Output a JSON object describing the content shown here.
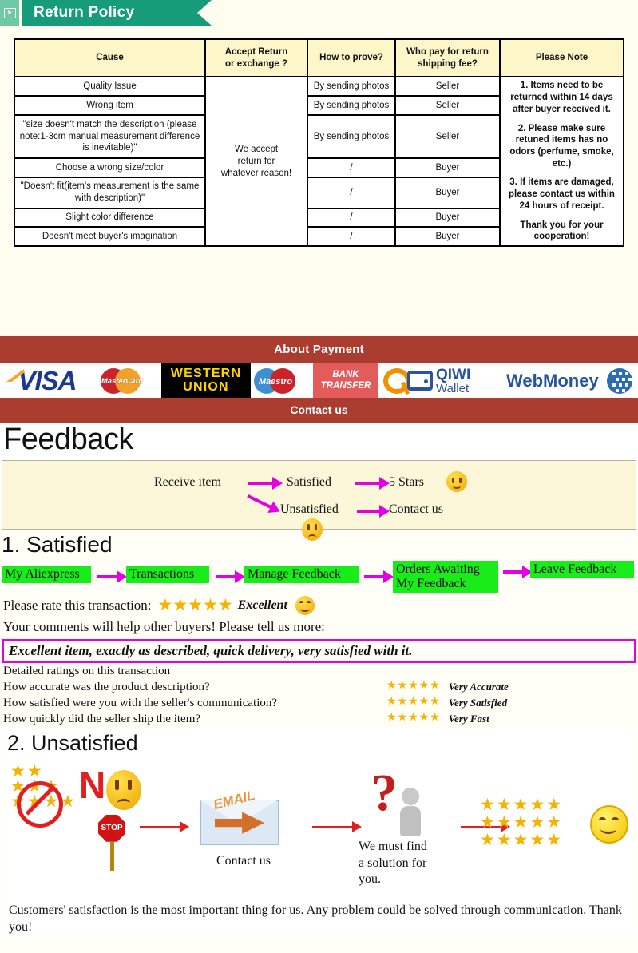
{
  "policy": {
    "banner_title": "Return Policy",
    "banner_icon": "arrow-badge-icon",
    "columns": [
      "Cause",
      "Accept Return\nor exchange ?",
      "How to prove?",
      "Who pay for return\nshipping fee?",
      "Please Note"
    ],
    "col_cause": "Cause",
    "col_accept": "Accept Return",
    "col_accept2": "or exchange ?",
    "col_prove": "How to prove?",
    "col_who1": "Who pay for return",
    "col_who2": "shipping fee?",
    "col_note": "Please Note",
    "accept_cell1": "We accept",
    "accept_cell2": "return for",
    "accept_cell3": "whatever reason!",
    "rows": [
      {
        "cause": "Quality Issue",
        "prove": "By sending photos",
        "who": "Seller"
      },
      {
        "cause": "Wrong item",
        "prove": "By sending photos",
        "who": "Seller"
      },
      {
        "cause": "\"size doesn't match the description (please note:1-3cm manual measurement difference is inevitable)\"",
        "prove": "By sending photos",
        "who": "Seller"
      },
      {
        "cause": "Choose a wrong size/color",
        "prove": "/",
        "who": "Buyer"
      },
      {
        "cause": "\"Doesn't fit(item's measurement is the same with description)\"",
        "prove": "/",
        "who": "Buyer"
      },
      {
        "cause": "Slight color difference",
        "prove": "/",
        "who": "Buyer"
      },
      {
        "cause": "Doesn't meet buyer's imagination",
        "prove": "/",
        "who": "Buyer"
      }
    ],
    "note_1": "1. Items need to be returned within 14 days after buyer received it.",
    "note_2": "2. Please make sure retuned items has no odors (perfume, smoke, etc.)",
    "note_3": "3. If items are damaged, please contact us within 24 hours of receipt.",
    "note_4": "Thank you for your cooperation!"
  },
  "payment": {
    "title": "About Payment",
    "contact_title": "Contact us",
    "logos": [
      {
        "name": "visa-logo",
        "text": "VISA"
      },
      {
        "name": "mastercard-logo",
        "text": "MasterCard"
      },
      {
        "name": "western-union-logo",
        "line1": "WESTERN",
        "line2": "UNION"
      },
      {
        "name": "maestro-logo",
        "text": "Maestro"
      },
      {
        "name": "bank-transfer-logo",
        "line1": "BANK",
        "line2": "TRANSFER"
      },
      {
        "name": "qiwi-wallet-logo",
        "line1": "QIWI",
        "line2": "Wallet"
      },
      {
        "name": "webmoney-logo",
        "text": "WebMoney"
      }
    ],
    "visa": "VISA",
    "mastercard": "MasterCard",
    "wu1": "WESTERN",
    "wu2": "UNION",
    "maestro": "Maestro",
    "bank1": "BANK",
    "bank2": "TRANSFER",
    "qiwi1": "QIWI",
    "qiwi2": "Wallet",
    "webmoney": "WebMoney",
    "bar_color": "#ab3c30"
  },
  "feedback": {
    "title": "Feedback",
    "flow": {
      "start": "Receive item",
      "satisfied": "Satisfied",
      "five_stars": "5 Stars",
      "unsatisfied": "Unsatisfied",
      "contact_us": "Contact us"
    }
  },
  "satisfied": {
    "heading": "1. Satisfied",
    "steps": [
      "My Aliexpress",
      "Transactions",
      "Manage Feedback",
      "Orders Awaiting My Feedback",
      "Leave Feedback"
    ],
    "step4_line1": "Orders Awaiting",
    "step4_line2": "My Feedback",
    "rate_label": "Please rate this transaction:",
    "rate_stars": "★★★★★",
    "rate_word": "Excellent",
    "comment_prompt": "Your comments will help other buyers! Please tell us more:",
    "comment_text": "Excellent item, exactly as described, quick delivery, very satisfied with it.",
    "detail_heading": "Detailed ratings on this transaction",
    "detail_rows": [
      {
        "question": "How accurate was the product description?",
        "stars": "★★★★★",
        "label": "Very Accurate"
      },
      {
        "question": "How satisfied were you with the seller's communication?",
        "stars": "★★★★★",
        "label": "Very Satisfied"
      },
      {
        "question": "How quickly did the seller ship the item?",
        "stars": "★★★★★",
        "label": "Very Fast"
      }
    ],
    "highlight_color": "#19ed19",
    "box_color": "#e300e3"
  },
  "unsatisfied": {
    "heading": "2. Unsatisfied",
    "no_text": "N",
    "stop_text": "STOP",
    "email_text": "EMAIL",
    "contact_caption": "Contact us",
    "solution_caption": "We must find\na solution for\nyou.",
    "solution_l1": "We must find",
    "solution_l2": "a solution for",
    "solution_l3": "you.",
    "question_mark": "?",
    "stars_row": "★★★★★",
    "footnote": "Customers' satisfaction is the most important thing for us. Any problem could be solved through communication. Thank you!"
  }
}
